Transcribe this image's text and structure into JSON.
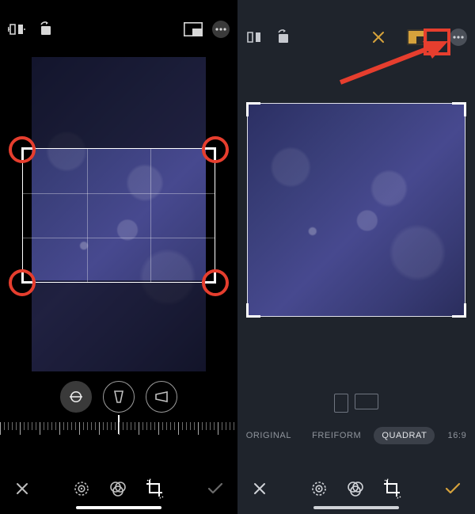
{
  "left": {
    "ratios": {
      "items": [
        "ORIGINAL",
        "FREIFORM",
        "QUADRAT",
        "16:9"
      ],
      "active": "QUADRAT"
    }
  },
  "right": {
    "ratios": {
      "items": [
        {
          "label": "ORIGINAL"
        },
        {
          "label": "FREIFORM"
        },
        {
          "label": "QUADRAT"
        },
        {
          "label": "16:9"
        }
      ],
      "active_index": 2
    }
  },
  "colors": {
    "accent": "#d6a23c",
    "annotation": "#e63e2e"
  }
}
